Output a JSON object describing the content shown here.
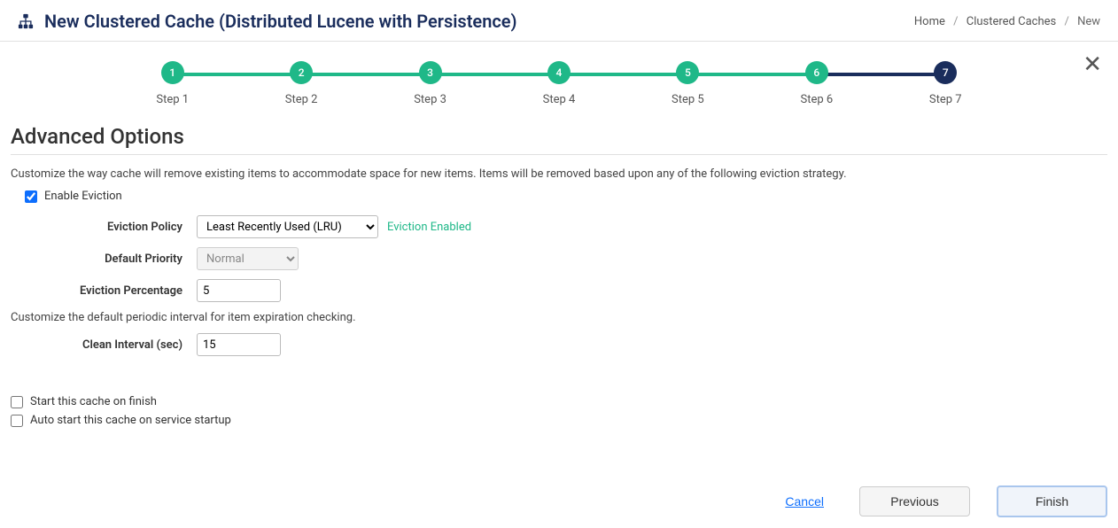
{
  "header": {
    "title": "New Clustered Cache (Distributed Lucene with Persistence)"
  },
  "breadcrumb": {
    "home": "Home",
    "caches": "Clustered Caches",
    "current": "New"
  },
  "stepper": {
    "s1": {
      "num": "1",
      "label": "Step 1"
    },
    "s2": {
      "num": "2",
      "label": "Step 2"
    },
    "s3": {
      "num": "3",
      "label": "Step 3"
    },
    "s4": {
      "num": "4",
      "label": "Step 4"
    },
    "s5": {
      "num": "5",
      "label": "Step 5"
    },
    "s6": {
      "num": "6",
      "label": "Step 6"
    },
    "s7": {
      "num": "7",
      "label": "Step 7"
    }
  },
  "section": {
    "title": "Advanced Options",
    "eviction_desc": "Customize the way cache will remove existing items to accommodate space for new items. Items will be removed based upon any of the following eviction strategy.",
    "clean_desc": "Customize the default periodic interval for item expiration checking."
  },
  "form": {
    "enable_eviction_label": "Enable Eviction",
    "eviction_policy_label": "Eviction Policy",
    "eviction_policy_value": "Least Recently Used (LRU)",
    "eviction_status": "Eviction Enabled",
    "default_priority_label": "Default Priority",
    "default_priority_value": "Normal",
    "eviction_percentage_label": "Eviction Percentage",
    "eviction_percentage_value": "5",
    "clean_interval_label": "Clean Interval (sec)",
    "clean_interval_value": "15",
    "start_on_finish_label": "Start this cache on finish",
    "auto_start_label": "Auto start this cache on service startup"
  },
  "actions": {
    "cancel": "Cancel",
    "previous": "Previous",
    "finish": "Finish"
  }
}
